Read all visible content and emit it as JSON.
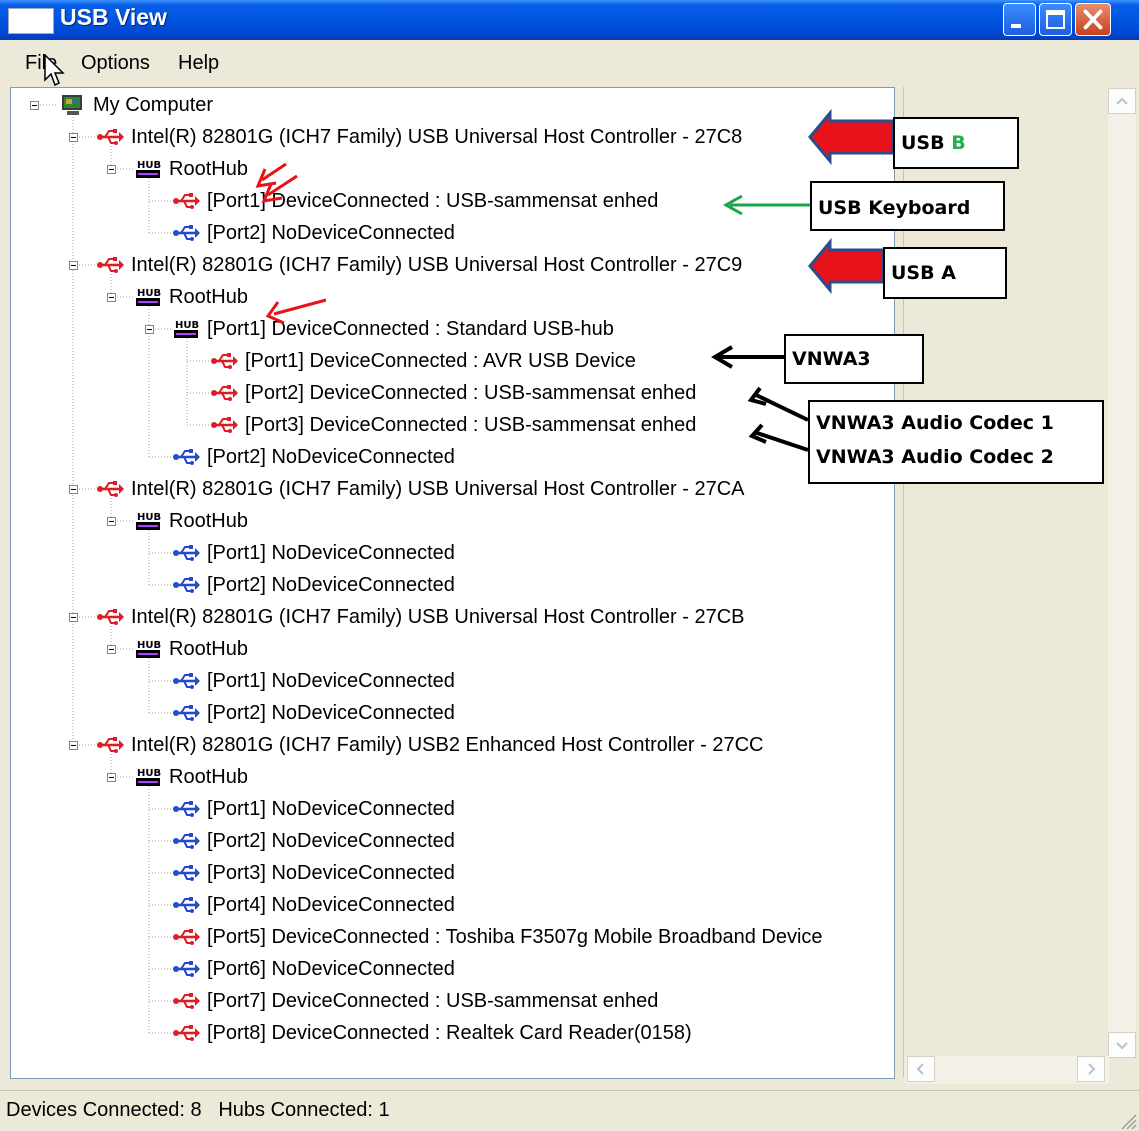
{
  "window": {
    "title": "USB View"
  },
  "menu": [
    {
      "label": "File"
    },
    {
      "label": "Options"
    },
    {
      "label": "Help"
    }
  ],
  "tree": [
    {
      "label": "My Computer",
      "kind": "computer",
      "depth": 0
    },
    {
      "label": "Intel(R) 82801G (ICH7 Family) USB Universal Host Controller - 27C8",
      "kind": "usb-red",
      "depth": 1
    },
    {
      "label": "RootHub",
      "kind": "hub",
      "depth": 2
    },
    {
      "label": "[Port1] DeviceConnected :  USB-sammensat enhed",
      "kind": "usb-red",
      "depth": 3
    },
    {
      "label": "[Port2] NoDeviceConnected",
      "kind": "usb-blue",
      "depth": 3
    },
    {
      "label": "Intel(R) 82801G (ICH7 Family) USB Universal Host Controller - 27C9",
      "kind": "usb-red",
      "depth": 1
    },
    {
      "label": "RootHub",
      "kind": "hub",
      "depth": 2
    },
    {
      "label": "[Port1] DeviceConnected :  Standard USB-hub",
      "kind": "hub",
      "depth": 3
    },
    {
      "label": "[Port1] DeviceConnected :  AVR USB Device",
      "kind": "usb-red",
      "depth": 4
    },
    {
      "label": "[Port2] DeviceConnected :  USB-sammensat enhed",
      "kind": "usb-red",
      "depth": 4
    },
    {
      "label": "[Port3] DeviceConnected :  USB-sammensat enhed",
      "kind": "usb-red",
      "depth": 4
    },
    {
      "label": "[Port2] NoDeviceConnected",
      "kind": "usb-blue",
      "depth": 3
    },
    {
      "label": "Intel(R) 82801G (ICH7 Family) USB Universal Host Controller - 27CA",
      "kind": "usb-red",
      "depth": 1
    },
    {
      "label": "RootHub",
      "kind": "hub",
      "depth": 2
    },
    {
      "label": "[Port1] NoDeviceConnected",
      "kind": "usb-blue",
      "depth": 3
    },
    {
      "label": "[Port2] NoDeviceConnected",
      "kind": "usb-blue",
      "depth": 3
    },
    {
      "label": "Intel(R) 82801G (ICH7 Family) USB Universal Host Controller - 27CB",
      "kind": "usb-red",
      "depth": 1
    },
    {
      "label": "RootHub",
      "kind": "hub",
      "depth": 2
    },
    {
      "label": "[Port1] NoDeviceConnected",
      "kind": "usb-blue",
      "depth": 3
    },
    {
      "label": "[Port2] NoDeviceConnected",
      "kind": "usb-blue",
      "depth": 3
    },
    {
      "label": "Intel(R) 82801G (ICH7 Family) USB2 Enhanced Host Controller - 27CC",
      "kind": "usb-red",
      "depth": 1
    },
    {
      "label": "RootHub",
      "kind": "hub",
      "depth": 2
    },
    {
      "label": "[Port1] NoDeviceConnected",
      "kind": "usb-blue",
      "depth": 3
    },
    {
      "label": "[Port2] NoDeviceConnected",
      "kind": "usb-blue",
      "depth": 3
    },
    {
      "label": "[Port3] NoDeviceConnected",
      "kind": "usb-blue",
      "depth": 3
    },
    {
      "label": "[Port4] NoDeviceConnected",
      "kind": "usb-blue",
      "depth": 3
    },
    {
      "label": "[Port5] DeviceConnected :  Toshiba F3507g Mobile Broadband Device",
      "kind": "usb-red",
      "depth": 3
    },
    {
      "label": "[Port6] NoDeviceConnected",
      "kind": "usb-blue",
      "depth": 3
    },
    {
      "label": "[Port7] DeviceConnected :  USB-sammensat enhed",
      "kind": "usb-red",
      "depth": 3
    },
    {
      "label": "[Port8] DeviceConnected :  Realtek Card Reader(0158)",
      "kind": "usb-red",
      "depth": 3
    }
  ],
  "annotations": {
    "usb_b": {
      "prefix": "USB ",
      "accent": "B"
    },
    "usb_keyboard": "USB Keyboard",
    "usb_a": "USB A",
    "vnwa3": "VNWA3",
    "codec": [
      "VNWA3 Audio Codec 1",
      "VNWA3 Audio Codec 2"
    ]
  },
  "status": {
    "devices": "Devices Connected: 8",
    "hubs": "Hubs Connected: 1"
  },
  "colors": {
    "titlebar": "#0054e3",
    "face": "#ece9d8",
    "usb_connected": "#e01b24",
    "usb_empty": "#1e4bd2",
    "accent_green": "#22b04b",
    "arrow_red": "#e8121a",
    "arrow_outline": "#2a4d8f",
    "arrow_green": "#1aa34a"
  }
}
